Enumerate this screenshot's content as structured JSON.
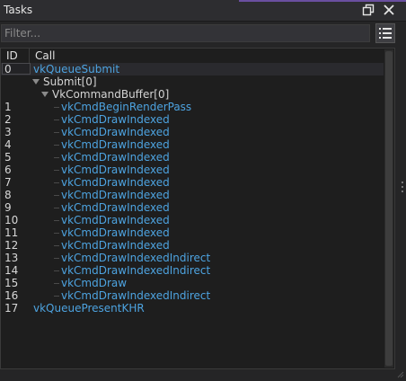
{
  "window": {
    "title": "Tasks"
  },
  "colors": {
    "accent": "#6a4fa0",
    "link": "#4da3e0"
  },
  "filter": {
    "placeholder": "Filter...",
    "value": ""
  },
  "table": {
    "headers": {
      "id": "ID",
      "call": "Call"
    },
    "rows": [
      {
        "id": "0",
        "call": "vkQueueSubmit",
        "indent": 0,
        "kind": "link",
        "expanded": false,
        "selected": true
      },
      {
        "id": "",
        "call": "Submit[0]",
        "indent": 1,
        "kind": "node",
        "expanded": true
      },
      {
        "id": "",
        "call": "VkCommandBuffer[0]",
        "indent": 2,
        "kind": "node",
        "expanded": true
      },
      {
        "id": "1",
        "call": "vkCmdBeginRenderPass",
        "indent": 3,
        "kind": "link"
      },
      {
        "id": "2",
        "call": "vkCmdDrawIndexed",
        "indent": 3,
        "kind": "link"
      },
      {
        "id": "3",
        "call": "vkCmdDrawIndexed",
        "indent": 3,
        "kind": "link"
      },
      {
        "id": "4",
        "call": "vkCmdDrawIndexed",
        "indent": 3,
        "kind": "link"
      },
      {
        "id": "5",
        "call": "vkCmdDrawIndexed",
        "indent": 3,
        "kind": "link"
      },
      {
        "id": "6",
        "call": "vkCmdDrawIndexed",
        "indent": 3,
        "kind": "link"
      },
      {
        "id": "7",
        "call": "vkCmdDrawIndexed",
        "indent": 3,
        "kind": "link"
      },
      {
        "id": "8",
        "call": "vkCmdDrawIndexed",
        "indent": 3,
        "kind": "link"
      },
      {
        "id": "9",
        "call": "vkCmdDrawIndexed",
        "indent": 3,
        "kind": "link"
      },
      {
        "id": "10",
        "call": "vkCmdDrawIndexed",
        "indent": 3,
        "kind": "link"
      },
      {
        "id": "11",
        "call": "vkCmdDrawIndexed",
        "indent": 3,
        "kind": "link"
      },
      {
        "id": "12",
        "call": "vkCmdDrawIndexed",
        "indent": 3,
        "kind": "link"
      },
      {
        "id": "13",
        "call": "vkCmdDrawIndexedIndirect",
        "indent": 3,
        "kind": "link"
      },
      {
        "id": "14",
        "call": "vkCmdDrawIndexedIndirect",
        "indent": 3,
        "kind": "link"
      },
      {
        "id": "15",
        "call": "vkCmdDraw",
        "indent": 3,
        "kind": "link"
      },
      {
        "id": "16",
        "call": "vkCmdDrawIndexedIndirect",
        "indent": 3,
        "kind": "link"
      },
      {
        "id": "17",
        "call": "vkQueuePresentKHR",
        "indent": 0,
        "kind": "link"
      }
    ]
  },
  "icons": {
    "restore": "restore-window-icon",
    "close": "close-icon",
    "list": "list-options-icon",
    "expand": "expand-arrow-icon",
    "grip": "splitter-grip-icon",
    "resize": "resize-grip-icon"
  }
}
